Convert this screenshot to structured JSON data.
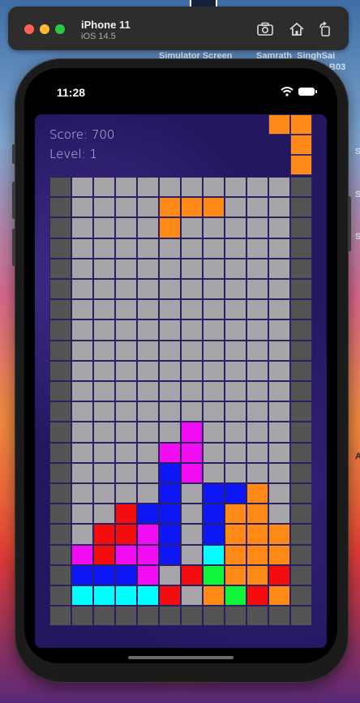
{
  "simulator": {
    "device_name": "iPhone 11",
    "os_version": "iOS 14.5",
    "toolbar_icons": [
      "screenshot-icon",
      "home-icon",
      "rotate-icon"
    ]
  },
  "desktop": {
    "labels": [
      "Simulator Screen",
      "Samrath_SinghSai",
      "B03",
      "S",
      "S",
      "S",
      "A"
    ]
  },
  "status_bar": {
    "time": "11:28"
  },
  "game": {
    "score_text": "Score: 700",
    "level_text": "Level: 1",
    "colors": {
      "empty": "#a7a4aa",
      "wall": "#545454",
      "orange": "#ff8a17",
      "red": "#f30d0d",
      "blue": "#0d17f5",
      "magenta": "#f10cf2",
      "cyan": "#00ffff",
      "green": "#0ff53a"
    },
    "next_piece": {
      "rows": [
        [
          "O",
          "O"
        ],
        [
          ".",
          "O"
        ],
        [
          ".",
          "O"
        ]
      ]
    },
    "board": {
      "legend": {
        "W": "wall",
        ".": "empty",
        "O": "orange",
        "R": "red",
        "B": "blue",
        "M": "magenta",
        "C": "cyan",
        "G": "green"
      },
      "rows": [
        "W..........W",
        "W....OOO...W",
        "W....O.....W",
        "W..........W",
        "W..........W",
        "W..........W",
        "W..........W",
        "W..........W",
        "W..........W",
        "W..........W",
        "W..........W",
        "W..........W",
        "W.....M....W",
        "W....MM....W",
        "W....BM....W",
        "W....B.BBO.W",
        "W..RBB.BOO.W",
        "W.RRMB.BOOOW",
        "WMRMMB.COOOW",
        "WBBBM.RGOORW",
        "WCCCCR.OGROW",
        "WWWWWWWWWWWW"
      ]
    }
  }
}
